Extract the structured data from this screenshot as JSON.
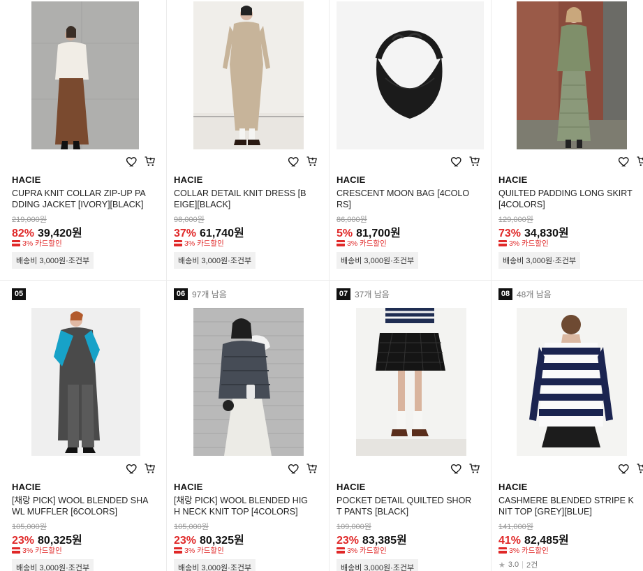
{
  "products": [
    {
      "rank": "",
      "stock": "",
      "brand": "HACIE",
      "name": "CUPRA KNIT COLLAR ZIP-UP PADDING JACKET [IVORY][BLACK]",
      "original_price": "219,000원",
      "discount": "82%",
      "price": "39,420원",
      "card_discount": "3% 카드할인",
      "shipping": "배송비 3,000원·조건부",
      "rating": "",
      "reviews": ""
    },
    {
      "rank": "",
      "stock": "",
      "brand": "HACIE",
      "name": "COLLAR DETAIL KNIT DRESS [BEIGE][BLACK]",
      "original_price": "98,000원",
      "discount": "37%",
      "price": "61,740원",
      "card_discount": "3% 카드할인",
      "shipping": "배송비 3,000원·조건부",
      "rating": "",
      "reviews": ""
    },
    {
      "rank": "",
      "stock": "",
      "brand": "HACIE",
      "name": "CRESCENT MOON BAG [4COLORS]",
      "original_price": "86,000원",
      "discount": "5%",
      "price": "81,700원",
      "card_discount": "3% 카드할인",
      "shipping": "배송비 3,000원·조건부",
      "rating": "",
      "reviews": ""
    },
    {
      "rank": "",
      "stock": "",
      "brand": "HACIE",
      "name": "QUILTED PADDING LONG SKIRT [4COLORS]",
      "original_price": "129,000원",
      "discount": "73%",
      "price": "34,830원",
      "card_discount": "3% 카드할인",
      "shipping": "배송비 3,000원·조건부",
      "rating": "",
      "reviews": ""
    },
    {
      "rank": "05",
      "stock": "",
      "brand": "HACIE",
      "name": "[채랑 PICK] WOOL BLENDED SHAWL MUFFLER [6COLORS]",
      "original_price": "105,000원",
      "discount": "23%",
      "price": "80,325원",
      "card_discount": "3% 카드할인",
      "shipping": "배송비 3,000원·조건부",
      "rating": "",
      "reviews": ""
    },
    {
      "rank": "06",
      "stock": "97개 남음",
      "brand": "HACIE",
      "name": "[채랑 PICK] WOOL BLENDED HIGH NECK KNIT TOP [4COLORS]",
      "original_price": "105,000원",
      "discount": "23%",
      "price": "80,325원",
      "card_discount": "3% 카드할인",
      "shipping": "배송비 3,000원·조건부",
      "rating": "",
      "reviews": ""
    },
    {
      "rank": "07",
      "stock": "37개 남음",
      "brand": "HACIE",
      "name": "POCKET DETAIL QUILTED SHORT PANTS [BLACK]",
      "original_price": "109,000원",
      "discount": "23%",
      "price": "83,385원",
      "card_discount": "3% 카드할인",
      "shipping": "배송비 3,000원·조건부",
      "rating": "",
      "reviews": ""
    },
    {
      "rank": "08",
      "stock": "48개 남음",
      "brand": "HACIE",
      "name": "CASHMERE BLENDED STRIPE KNIT TOP [GREY][BLUE]",
      "original_price": "141,000원",
      "discount": "41%",
      "price": "82,485원",
      "card_discount": "3% 카드할인",
      "shipping": "",
      "rating": "3.0",
      "reviews": "2건"
    }
  ],
  "icons": {
    "wishlist": "heart-icon",
    "cart": "cart-icon",
    "rating": "star-icon",
    "card": "card-icon"
  },
  "colors": {
    "discount": "#e02828",
    "rank_badge": "#111111",
    "shipping_bg": "#f1f1f1"
  }
}
